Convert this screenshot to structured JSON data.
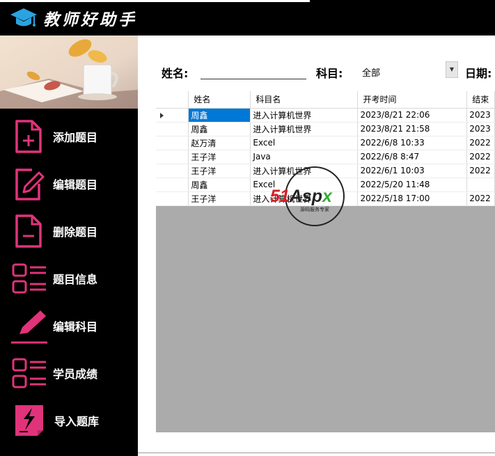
{
  "app": {
    "title": "教师好助手"
  },
  "sidebar": {
    "items": [
      {
        "label": "添加题目",
        "icon": "add-document-icon"
      },
      {
        "label": "编辑题目",
        "icon": "edit-document-icon"
      },
      {
        "label": "删除题目",
        "icon": "remove-document-icon"
      },
      {
        "label": "题目信息",
        "icon": "list-icon"
      },
      {
        "label": "编辑科目",
        "icon": "pencil-icon"
      },
      {
        "label": "学员成绩",
        "icon": "list-icon"
      },
      {
        "label": "导入题库",
        "icon": "import-icon"
      }
    ]
  },
  "filter": {
    "name_label": "姓名:",
    "name_value": "",
    "subject_label": "科目:",
    "subject_value": "全部",
    "date_label": "日期:"
  },
  "grid": {
    "columns": [
      "姓名",
      "科目名",
      "开考时间",
      "结束"
    ],
    "rows": [
      {
        "name": "周鑫",
        "subject": "进入计算机世界",
        "start": "2023/8/21 22:06",
        "end": "2023"
      },
      {
        "name": "周鑫",
        "subject": "进入计算机世界",
        "start": "2023/8/21 21:58",
        "end": "2023"
      },
      {
        "name": "赵万清",
        "subject": "Excel",
        "start": "2022/6/8 10:33",
        "end": "2022"
      },
      {
        "name": "王子洋",
        "subject": "Java",
        "start": "2022/6/8 8:47",
        "end": "2022"
      },
      {
        "name": "王子洋",
        "subject": "进入计算机世界",
        "start": "2022/6/1 10:03",
        "end": "2022"
      },
      {
        "name": "周鑫",
        "subject": "Excel",
        "start": "2022/5/20 11:48",
        "end": ""
      },
      {
        "name": "王子洋",
        "subject": "进入计算机世界",
        "start": "2022/5/18 17:00",
        "end": "2022"
      }
    ]
  },
  "watermark": {
    "brand": "51Aspx",
    "tagline": "源码服务专家"
  },
  "colors": {
    "accent": "#e0337a",
    "selection": "#0078d7",
    "grid_background": "#ababab"
  }
}
